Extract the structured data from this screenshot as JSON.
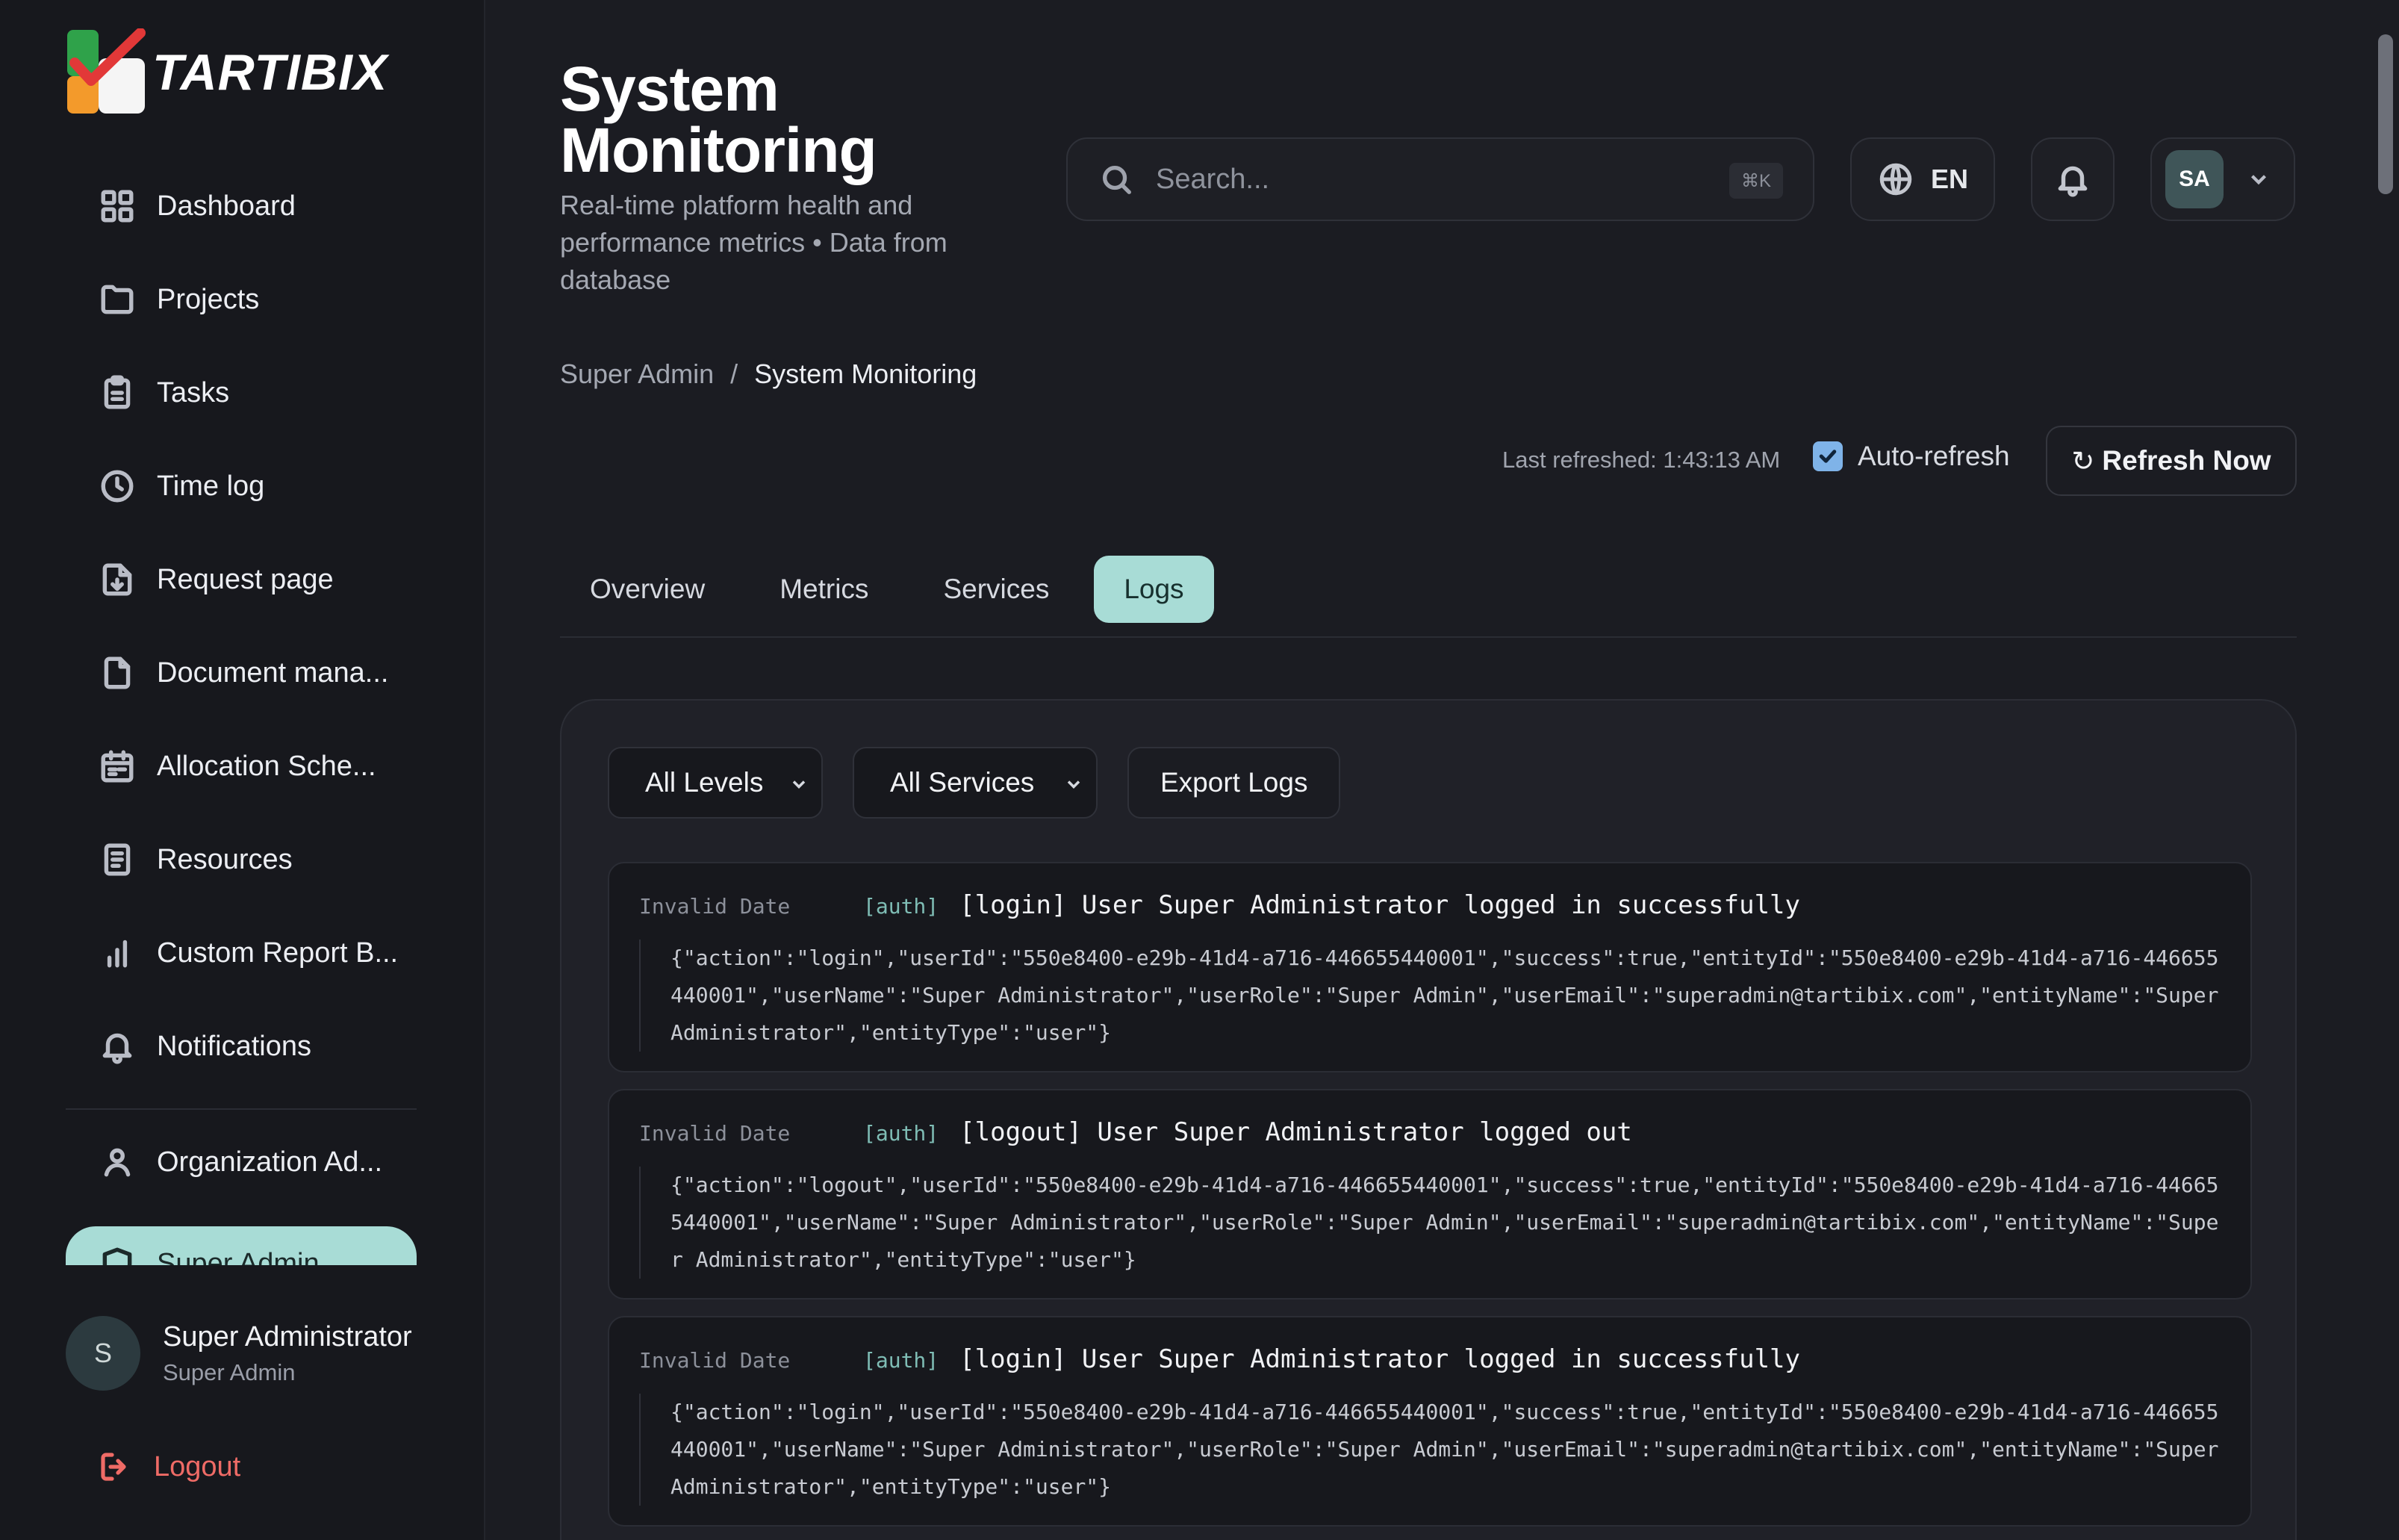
{
  "brand": {
    "name": "TARTIBIX"
  },
  "sidebar": {
    "items": [
      {
        "label": "Dashboard",
        "icon": "grid-icon"
      },
      {
        "label": "Projects",
        "icon": "folder-icon"
      },
      {
        "label": "Tasks",
        "icon": "clipboard-icon"
      },
      {
        "label": "Time log",
        "icon": "clock-icon"
      },
      {
        "label": "Request page",
        "icon": "file-download-icon"
      },
      {
        "label": "Document mana...",
        "icon": "document-icon"
      },
      {
        "label": "Allocation Sche...",
        "icon": "calendar-icon"
      },
      {
        "label": "Resources",
        "icon": "book-icon"
      },
      {
        "label": "Custom Report B...",
        "icon": "bar-chart-icon"
      },
      {
        "label": "Notifications",
        "icon": "bell-icon"
      }
    ],
    "org_item": {
      "label": "Organization Ad...",
      "icon": "user-icon"
    },
    "active_item": {
      "label": "Super Admin",
      "icon": "shield-icon",
      "accent": "#a8dcd6"
    },
    "user": {
      "initial": "S",
      "name": "Super Administrator",
      "role": "Super Admin"
    },
    "logout_label": "Logout"
  },
  "header": {
    "title": "System Monitoring",
    "subtitle": "Real-time platform health and performance metrics • Data from database",
    "search": {
      "placeholder": "Search...",
      "shortcut": "⌘K"
    },
    "language": "EN",
    "profile_initials": "SA"
  },
  "breadcrumb": {
    "parent": "Super Admin",
    "separator": "/",
    "current": "System Monitoring"
  },
  "refresh": {
    "last_refreshed": "Last refreshed: 1:43:13 AM",
    "auto_refresh_label": "Auto-refresh",
    "auto_refresh_checked": true,
    "refresh_symbol": "↻",
    "refresh_button": "Refresh Now"
  },
  "tabs": [
    {
      "label": "Overview",
      "active": false
    },
    {
      "label": "Metrics",
      "active": false
    },
    {
      "label": "Services",
      "active": false
    },
    {
      "label": "Logs",
      "active": true
    }
  ],
  "logs_panel": {
    "level_filter": "All Levels",
    "service_filter": "All Services",
    "export_label": "Export Logs",
    "entries": [
      {
        "date": "Invalid Date",
        "service": "[auth]",
        "message": "[login] User Super Administrator logged in successfully",
        "detail": "{\"action\":\"login\",\"userId\":\"550e8400-e29b-41d4-a716-446655440001\",\"success\":true,\"entityId\":\"550e8400-e29b-41d4-a716-446655440001\",\"userName\":\"Super Administrator\",\"userRole\":\"Super Admin\",\"userEmail\":\"superadmin@tartibix.com\",\"entityName\":\"Super Administrator\",\"entityType\":\"user\"}"
      },
      {
        "date": "Invalid Date",
        "service": "[auth]",
        "message": "[logout] User Super Administrator logged out",
        "detail": "{\"action\":\"logout\",\"userId\":\"550e8400-e29b-41d4-a716-446655440001\",\"success\":true,\"entityId\":\"550e8400-e29b-41d4-a716-446655440001\",\"userName\":\"Super Administrator\",\"userRole\":\"Super Admin\",\"userEmail\":\"superadmin@tartibix.com\",\"entityName\":\"Super Administrator\",\"entityType\":\"user\"}"
      },
      {
        "date": "Invalid Date",
        "service": "[auth]",
        "message": "[login] User Super Administrator logged in successfully",
        "detail": "{\"action\":\"login\",\"userId\":\"550e8400-e29b-41d4-a716-446655440001\",\"success\":true,\"entityId\":\"550e8400-e29b-41d4-a716-446655440001\",\"userName\":\"Super Administrator\",\"userRole\":\"Super Admin\",\"userEmail\":\"superadmin@tartibix.com\",\"entityName\":\"Super Administrator\",\"entityType\":\"user\"}"
      }
    ]
  }
}
